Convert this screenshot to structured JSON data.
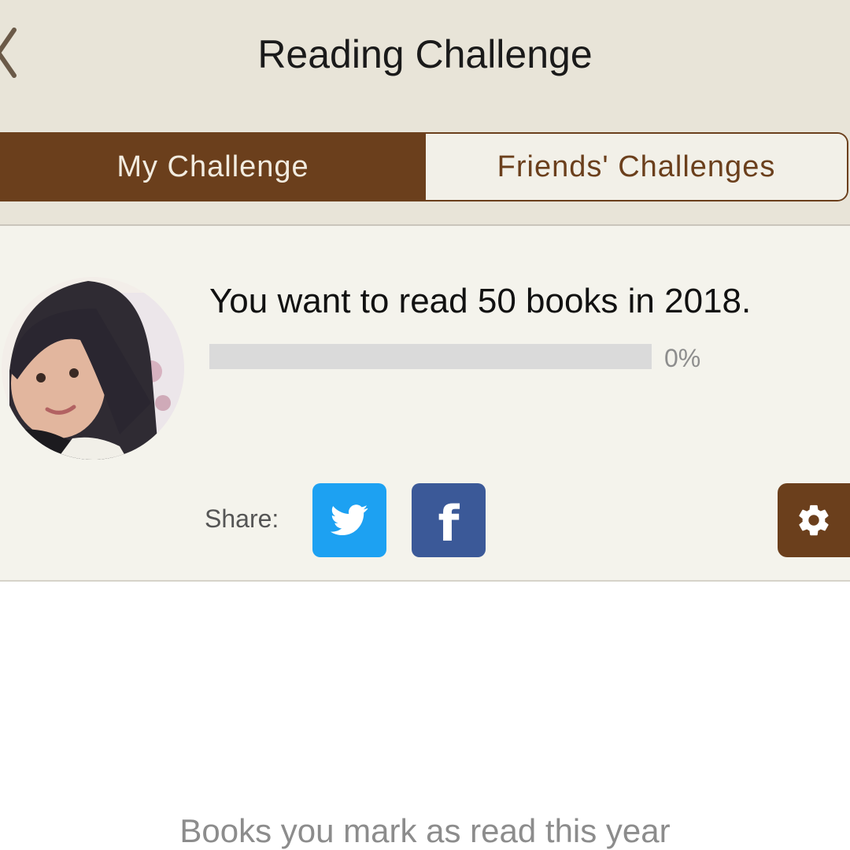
{
  "header": {
    "title": "Reading Challenge",
    "back_icon": "chevron-left-icon"
  },
  "tabs": [
    {
      "label": "My Challenge",
      "active": true
    },
    {
      "label": "Friends' Challenges",
      "active": false
    }
  ],
  "challenge": {
    "goal_text": "You want to read 50 books in 2018.",
    "progress_percent": 0,
    "progress_label": "0%",
    "share_label": "Share:",
    "share_buttons": [
      {
        "icon": "twitter-icon",
        "color": "#1da1f2"
      },
      {
        "icon": "facebook-icon",
        "glyph": "f",
        "color": "#3b5998"
      }
    ],
    "settings_icon": "gear-icon"
  },
  "read_books": {
    "empty_text": "Books you mark as read this year"
  },
  "colors": {
    "brand_brown": "#6b3f1c",
    "nav_background": "#e8e4d8",
    "card_background": "#f4f3ec"
  }
}
